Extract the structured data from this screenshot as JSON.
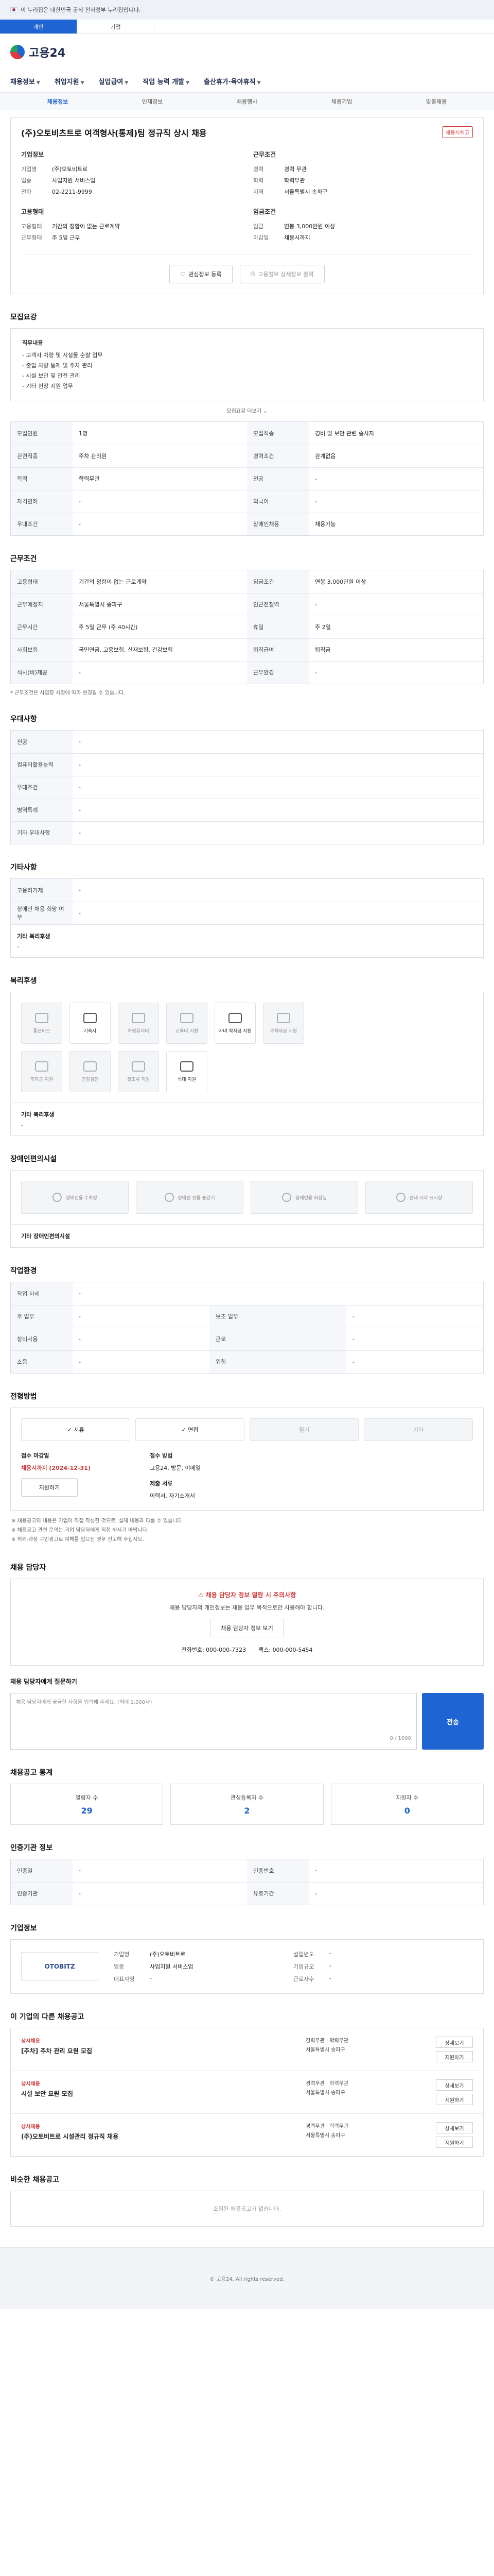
{
  "gov_banner": "이 누리집은 대한민국 공식 전자정부 누리집입니다.",
  "top_tabs": [
    "개인",
    "기업"
  ],
  "logo": "고용24",
  "nav": [
    "채용정보",
    "취업지원",
    "실업급여",
    "직업 능력 개발",
    "출산휴가·육아휴직"
  ],
  "sub_nav": [
    "채용정보",
    "인재정보",
    "채용행사",
    "채용기업",
    "맞춤채용"
  ],
  "job": {
    "title": "(주)오토비츠트로 여객형사(통제)팀 정규직 상시 채용",
    "report": "채용시해고",
    "company_head": "기업정보",
    "company": [
      {
        "k": "기업명",
        "v": "(주)오토비트로"
      },
      {
        "k": "업종",
        "v": "사업지원 서비스업"
      },
      {
        "k": "전화",
        "v": "02-2211-9999"
      }
    ],
    "condition_head": "근무조건",
    "condition": [
      {
        "k": "경력",
        "v": "경력 무관"
      },
      {
        "k": "학력",
        "v": "학력무관"
      },
      {
        "k": "지역",
        "v": "서울특별시 송파구"
      }
    ],
    "apply_head": "고용형태",
    "apply": [
      {
        "k": "고용형태",
        "v": "기간의 정함이 없는 근로계약"
      },
      {
        "k": "근무형태",
        "v": "주 5일 근무"
      }
    ],
    "pay_head": "임금조건",
    "pay": [
      {
        "k": "임금",
        "v": "연봉 3,000만원 이상"
      },
      {
        "k": "마감일",
        "v": "채용시까지"
      }
    ],
    "btn_interest": "관심정보 등록",
    "btn_compare": "고용정보 상세정보 출력"
  },
  "duty": {
    "title": "모집요강",
    "head": "직무내용",
    "lines": [
      "- 고객사 차량 및 시설물 순찰 업무",
      "- 출입 차량 통제 및 주차 관리",
      "- 시설 보안 및 안전 관리",
      "- 기타 현장 지원 업무"
    ],
    "more": "모집요강 더보기"
  },
  "recruit_rows": [
    {
      "k": "모집인원",
      "v": "1명",
      "k2": "모집직종",
      "v2": "경비 및 보안 관련 종사자"
    },
    {
      "k": "관련직종",
      "v": "주차 관리원",
      "k2": "경력조건",
      "v2": "관계없음"
    },
    {
      "k": "학력",
      "v": "학력무관",
      "k2": "전공",
      "v2": "-"
    },
    {
      "k": "자격면허",
      "v": "-",
      "k2": "외국어",
      "v2": "-"
    },
    {
      "k": "우대조건",
      "v": "-",
      "k2": "장애인채용",
      "v2": "채용가능"
    }
  ],
  "work": {
    "title": "근무조건",
    "rows": [
      {
        "k": "고용형태",
        "v": "기간의 정함이 없는 근로계약",
        "k2": "임금조건",
        "v2": "연봉 3,000만원 이상"
      },
      {
        "k": "근무예정지",
        "v": "서울특별시 송파구",
        "k2": "인근전철역",
        "v2": "-"
      },
      {
        "k": "근무시간",
        "v": "주 5일 근무 (주 40시간)",
        "k2": "휴일",
        "v2": "주 2일"
      },
      {
        "k": "사회보험",
        "v": "국민연금, 고용보험, 산재보험, 건강보험",
        "k2": "퇴직급여",
        "v2": "퇴직금"
      },
      {
        "k": "식사(비)제공",
        "v": "-",
        "k2": "근무환경",
        "v2": "-"
      }
    ],
    "note": "* 근무조건은 사업장 사정에 따라 변경될 수 있습니다."
  },
  "prefer": {
    "title": "우대사항",
    "rows": [
      {
        "k": "전공",
        "v": "-"
      },
      {
        "k": "컴퓨터활용능력",
        "v": "-"
      },
      {
        "k": "우대조건",
        "v": "-"
      },
      {
        "k": "병역특례",
        "v": "-"
      },
      {
        "k": "기타 우대사항",
        "v": "-"
      }
    ]
  },
  "etc": {
    "title": "기타사항",
    "rows": [
      {
        "k": "고용허가제",
        "v": "-"
      },
      {
        "k": "장애인 채용 희망 여부",
        "v": "-"
      }
    ],
    "sub_head": "기타 복리후생",
    "sub_val": "-"
  },
  "benefits": {
    "title": "복리후생",
    "items": [
      {
        "label": "통근버스",
        "on": false
      },
      {
        "label": "기숙사",
        "on": true
      },
      {
        "label": "차량유지비",
        "on": false
      },
      {
        "label": "교육비 지원",
        "on": false
      },
      {
        "label": "자녀 학자금 지원",
        "on": true
      },
      {
        "label": "주택자금 지원",
        "on": false
      },
      {
        "label": "학자금 지원",
        "on": false
      },
      {
        "label": "건강검진",
        "on": false
      },
      {
        "label": "경조사 지원",
        "on": false
      },
      {
        "label": "식대 지원",
        "on": true
      }
    ],
    "extra_head": "기타 복리후생",
    "extra_val": "-"
  },
  "facility": {
    "title": "장애인편의시설",
    "items": [
      "장애인용 주차장",
      "장애인 전용 승강기",
      "장애인용 화장실",
      "안내 시각 표시장"
    ],
    "extra_head": "기타 장애인편의시설"
  },
  "prefer2": {
    "title": "작업환경",
    "rows": [
      {
        "k": "작업 자세",
        "v": "-",
        "k2": "",
        "v2": ""
      },
      {
        "k": "주 업무",
        "v": "-",
        "k2": "보조 업무",
        "v2": "-"
      },
      {
        "k": "장비사용",
        "v": "-",
        "k2": "근로",
        "v2": "-"
      },
      {
        "k": "소음",
        "v": "-",
        "k2": "위험",
        "v2": "-"
      }
    ]
  },
  "process": {
    "title": "전형방법",
    "steps": [
      {
        "label": "서류",
        "on": true
      },
      {
        "label": "면접",
        "on": true
      },
      {
        "label": "필기",
        "on": false
      },
      {
        "label": "기타",
        "on": false
      }
    ],
    "deadline_label": "접수 마감일",
    "deadline_val": "채용시까지 (2024-12-31)",
    "deadline_btn": "지원하기",
    "method_label": "접수 방법",
    "method_val": "고용24, 방문, 이메일",
    "docs_label": "제출 서류",
    "docs_val": "이력서, 자기소개서",
    "notices": [
      "※ 채용공고의 내용은 기업이 직접 작성한 것으로, 실제 내용과 다를 수 있습니다.",
      "※ 채용공고 관련 문의는 기업 담당자에게 직접 하시기 바랍니다.",
      "※ 허위·과장 구인광고로 피해를 입으신 경우 신고해 주십시오."
    ]
  },
  "manager": {
    "title": "채용 담당자",
    "warn": "채용 담당자 정보 열람 시 주의사항",
    "desc": "채용 담당자의 개인정보는 채용 업무 목적으로만 사용해야 합니다.",
    "btn": "채용 담당자 정보 보기",
    "phone_label": "전화번호",
    "phone": "000-000-7323",
    "fax_label": "팩스",
    "fax": "000-000-5454"
  },
  "inquiry": {
    "title": "채용 담당자에게 질문하기",
    "placeholder": "채용 담당자에게 궁금한 사항을 입력해 주세요. (최대 1,000자)",
    "count": "0 / 1000",
    "send": "전송"
  },
  "stats": {
    "title": "채용공고 통계",
    "items": [
      {
        "label": "열람자 수",
        "num": "29"
      },
      {
        "label": "관심등록자 수",
        "num": "2"
      },
      {
        "label": "지원자 수",
        "num": "0"
      }
    ]
  },
  "posting": {
    "title": "인증기관 정보",
    "rows": [
      {
        "k": "인증일",
        "v": "-",
        "k2": "인증번호",
        "v2": "-"
      },
      {
        "k": "인증기관",
        "v": "-",
        "k2": "유효기간",
        "v2": "-"
      }
    ]
  },
  "company_info": {
    "title": "기업정보",
    "logo": "OTOBITZ",
    "rows": [
      {
        "k": "기업명",
        "v": "(주)오토비트로"
      },
      {
        "k": "설립년도",
        "v": "-"
      },
      {
        "k": "업종",
        "v": "사업지원 서비스업"
      },
      {
        "k": "기업규모",
        "v": "-"
      },
      {
        "k": "대표자명",
        "v": "-"
      },
      {
        "k": "근로자수",
        "v": "-"
      }
    ]
  },
  "other_jobs": {
    "title": "이 기업의 다른 채용공고",
    "items": [
      {
        "tag": "상시채용",
        "title": "[주차] 주차 관리 요원 모집",
        "meta": "경력무관 · 학력무관",
        "loc": "서울특별시 송파구"
      },
      {
        "tag": "상시채용",
        "title": "시설 보안 요원 모집",
        "meta": "경력무관 · 학력무관",
        "loc": "서울특별시 송파구"
      },
      {
        "tag": "상시채용",
        "title": "(주)오토비트로 시설관리 정규직 채용",
        "meta": "경력무관 · 학력무관",
        "loc": "서울특별시 송파구"
      }
    ],
    "btn_detail": "상세보기",
    "btn_apply": "지원하기"
  },
  "similar": {
    "title": "비슷한 채용공고",
    "empty": "조회된 채용공고가 없습니다."
  },
  "footer": "© 고용24. All rights reserved."
}
